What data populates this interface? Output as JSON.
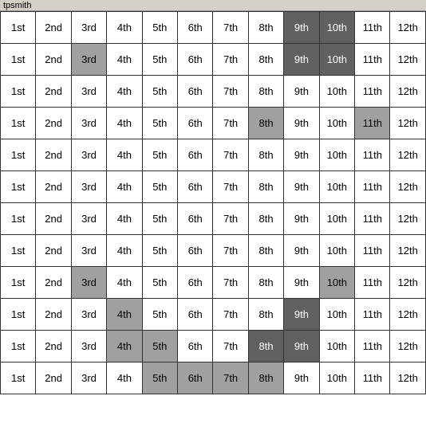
{
  "title": "tpsmith",
  "columns": [
    "1st",
    "2nd",
    "3rd",
    "4th",
    "5th",
    "6th",
    "7th",
    "8th",
    "9th",
    "10th",
    "11th",
    "12th"
  ],
  "rows": [
    {
      "cells": [
        {
          "text": "1st",
          "style": ""
        },
        {
          "text": "2nd",
          "style": ""
        },
        {
          "text": "3rd",
          "style": ""
        },
        {
          "text": "4th",
          "style": ""
        },
        {
          "text": "5th",
          "style": ""
        },
        {
          "text": "6th",
          "style": ""
        },
        {
          "text": "7th",
          "style": ""
        },
        {
          "text": "8th",
          "style": ""
        },
        {
          "text": "9th",
          "style": "highlight-dark"
        },
        {
          "text": "10th",
          "style": "highlight-dark"
        },
        {
          "text": "11th",
          "style": ""
        },
        {
          "text": "12th",
          "style": ""
        }
      ]
    },
    {
      "cells": [
        {
          "text": "1st",
          "style": ""
        },
        {
          "text": "2nd",
          "style": ""
        },
        {
          "text": "3rd",
          "style": "highlight-gray"
        },
        {
          "text": "4th",
          "style": ""
        },
        {
          "text": "5th",
          "style": ""
        },
        {
          "text": "6th",
          "style": ""
        },
        {
          "text": "7th",
          "style": ""
        },
        {
          "text": "8th",
          "style": ""
        },
        {
          "text": "9th",
          "style": "highlight-dark"
        },
        {
          "text": "10th",
          "style": "highlight-dark"
        },
        {
          "text": "11th",
          "style": ""
        },
        {
          "text": "12th",
          "style": ""
        }
      ]
    },
    {
      "cells": [
        {
          "text": "1st",
          "style": ""
        },
        {
          "text": "2nd",
          "style": ""
        },
        {
          "text": "3rd",
          "style": ""
        },
        {
          "text": "4th",
          "style": ""
        },
        {
          "text": "5th",
          "style": ""
        },
        {
          "text": "6th",
          "style": ""
        },
        {
          "text": "7th",
          "style": ""
        },
        {
          "text": "8th",
          "style": ""
        },
        {
          "text": "9th",
          "style": ""
        },
        {
          "text": "10th",
          "style": ""
        },
        {
          "text": "11th",
          "style": ""
        },
        {
          "text": "12th",
          "style": ""
        }
      ]
    },
    {
      "cells": [
        {
          "text": "1st",
          "style": ""
        },
        {
          "text": "2nd",
          "style": ""
        },
        {
          "text": "3rd",
          "style": ""
        },
        {
          "text": "4th",
          "style": ""
        },
        {
          "text": "5th",
          "style": ""
        },
        {
          "text": "6th",
          "style": ""
        },
        {
          "text": "7th",
          "style": ""
        },
        {
          "text": "8th",
          "style": "highlight-gray"
        },
        {
          "text": "9th",
          "style": ""
        },
        {
          "text": "10th",
          "style": ""
        },
        {
          "text": "11th",
          "style": "highlight-gray"
        },
        {
          "text": "12th",
          "style": ""
        }
      ]
    },
    {
      "cells": [
        {
          "text": "1st",
          "style": ""
        },
        {
          "text": "2nd",
          "style": ""
        },
        {
          "text": "3rd",
          "style": ""
        },
        {
          "text": "4th",
          "style": ""
        },
        {
          "text": "5th",
          "style": ""
        },
        {
          "text": "6th",
          "style": ""
        },
        {
          "text": "7th",
          "style": ""
        },
        {
          "text": "8th",
          "style": ""
        },
        {
          "text": "9th",
          "style": ""
        },
        {
          "text": "10th",
          "style": ""
        },
        {
          "text": "11th",
          "style": ""
        },
        {
          "text": "12th",
          "style": ""
        }
      ]
    },
    {
      "cells": [
        {
          "text": "1st",
          "style": ""
        },
        {
          "text": "2nd",
          "style": ""
        },
        {
          "text": "3rd",
          "style": ""
        },
        {
          "text": "4th",
          "style": ""
        },
        {
          "text": "5th",
          "style": ""
        },
        {
          "text": "6th",
          "style": ""
        },
        {
          "text": "7th",
          "style": ""
        },
        {
          "text": "8th",
          "style": ""
        },
        {
          "text": "9th",
          "style": ""
        },
        {
          "text": "10th",
          "style": ""
        },
        {
          "text": "11th",
          "style": ""
        },
        {
          "text": "12th",
          "style": ""
        }
      ]
    },
    {
      "cells": [
        {
          "text": "1st",
          "style": ""
        },
        {
          "text": "2nd",
          "style": ""
        },
        {
          "text": "3rd",
          "style": ""
        },
        {
          "text": "4th",
          "style": ""
        },
        {
          "text": "5th",
          "style": ""
        },
        {
          "text": "6th",
          "style": ""
        },
        {
          "text": "7th",
          "style": ""
        },
        {
          "text": "8th",
          "style": ""
        },
        {
          "text": "9th",
          "style": ""
        },
        {
          "text": "10th",
          "style": ""
        },
        {
          "text": "11th",
          "style": ""
        },
        {
          "text": "12th",
          "style": ""
        }
      ]
    },
    {
      "cells": [
        {
          "text": "1st",
          "style": ""
        },
        {
          "text": "2nd",
          "style": ""
        },
        {
          "text": "3rd",
          "style": ""
        },
        {
          "text": "4th",
          "style": ""
        },
        {
          "text": "5th",
          "style": ""
        },
        {
          "text": "6th",
          "style": ""
        },
        {
          "text": "7th",
          "style": ""
        },
        {
          "text": "8th",
          "style": ""
        },
        {
          "text": "9th",
          "style": ""
        },
        {
          "text": "10th",
          "style": ""
        },
        {
          "text": "11th",
          "style": ""
        },
        {
          "text": "12th",
          "style": ""
        }
      ]
    },
    {
      "cells": [
        {
          "text": "1st",
          "style": ""
        },
        {
          "text": "2nd",
          "style": ""
        },
        {
          "text": "3rd",
          "style": "highlight-gray"
        },
        {
          "text": "4th",
          "style": ""
        },
        {
          "text": "5th",
          "style": ""
        },
        {
          "text": "6th",
          "style": ""
        },
        {
          "text": "7th",
          "style": ""
        },
        {
          "text": "8th",
          "style": ""
        },
        {
          "text": "9th",
          "style": ""
        },
        {
          "text": "10th",
          "style": "highlight-gray"
        },
        {
          "text": "11th",
          "style": ""
        },
        {
          "text": "12th",
          "style": ""
        }
      ]
    },
    {
      "cells": [
        {
          "text": "1st",
          "style": ""
        },
        {
          "text": "2nd",
          "style": ""
        },
        {
          "text": "3rd",
          "style": ""
        },
        {
          "text": "4th",
          "style": "highlight-gray"
        },
        {
          "text": "5th",
          "style": ""
        },
        {
          "text": "6th",
          "style": ""
        },
        {
          "text": "7th",
          "style": ""
        },
        {
          "text": "8th",
          "style": ""
        },
        {
          "text": "9th",
          "style": "highlight-dark"
        },
        {
          "text": "10th",
          "style": ""
        },
        {
          "text": "11th",
          "style": ""
        },
        {
          "text": "12th",
          "style": ""
        }
      ]
    },
    {
      "cells": [
        {
          "text": "1st",
          "style": ""
        },
        {
          "text": "2nd",
          "style": ""
        },
        {
          "text": "3rd",
          "style": ""
        },
        {
          "text": "4th",
          "style": "highlight-gray"
        },
        {
          "text": "5th",
          "style": "highlight-gray"
        },
        {
          "text": "6th",
          "style": ""
        },
        {
          "text": "7th",
          "style": ""
        },
        {
          "text": "8th",
          "style": "highlight-dark"
        },
        {
          "text": "9th",
          "style": "highlight-dark"
        },
        {
          "text": "10th",
          "style": ""
        },
        {
          "text": "11th",
          "style": ""
        },
        {
          "text": "12th",
          "style": ""
        }
      ]
    },
    {
      "cells": [
        {
          "text": "1st",
          "style": ""
        },
        {
          "text": "2nd",
          "style": ""
        },
        {
          "text": "3rd",
          "style": ""
        },
        {
          "text": "4th",
          "style": ""
        },
        {
          "text": "5th",
          "style": "highlight-gray"
        },
        {
          "text": "6th",
          "style": "highlight-gray"
        },
        {
          "text": "7th",
          "style": "highlight-gray"
        },
        {
          "text": "8th",
          "style": "highlight-gray"
        },
        {
          "text": "9th",
          "style": ""
        },
        {
          "text": "10th",
          "style": ""
        },
        {
          "text": "11th",
          "style": ""
        },
        {
          "text": "12th",
          "style": ""
        }
      ]
    }
  ]
}
